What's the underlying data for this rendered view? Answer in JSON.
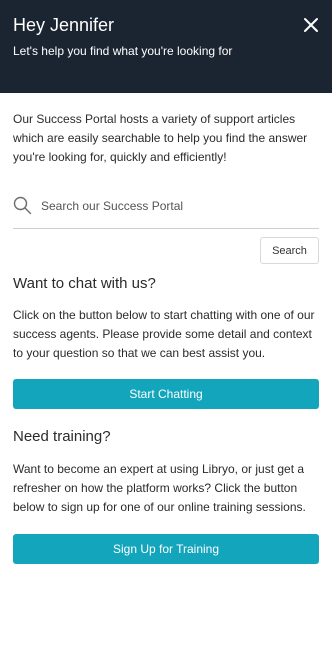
{
  "header": {
    "title": "Hey Jennifer",
    "subtitle": "Let's help you find what you're looking for",
    "close_icon": "close-icon"
  },
  "intro": {
    "text": "Our Success Portal hosts a variety of support articles which are easily searchable to help you find the answer you're looking for, quickly and efficiently!"
  },
  "search": {
    "icon": "search-icon",
    "placeholder": "Search our Success Portal",
    "value": "",
    "button_label": "Search"
  },
  "chat": {
    "title": "Want to chat with us?",
    "text": "Click on the button below to start chatting with one of our success agents. Please provide some detail and context to your question so that we can best assist you.",
    "button_label": "Start Chatting"
  },
  "training": {
    "title": "Need training?",
    "text": "Want to become an expert at using Libryo, or just get a refresher on how the platform works? Click the button below to sign up for one of our online training sessions.",
    "button_label": "Sign Up for Training"
  },
  "colors": {
    "header_bg": "#1b2532",
    "accent": "#13a5bc"
  }
}
